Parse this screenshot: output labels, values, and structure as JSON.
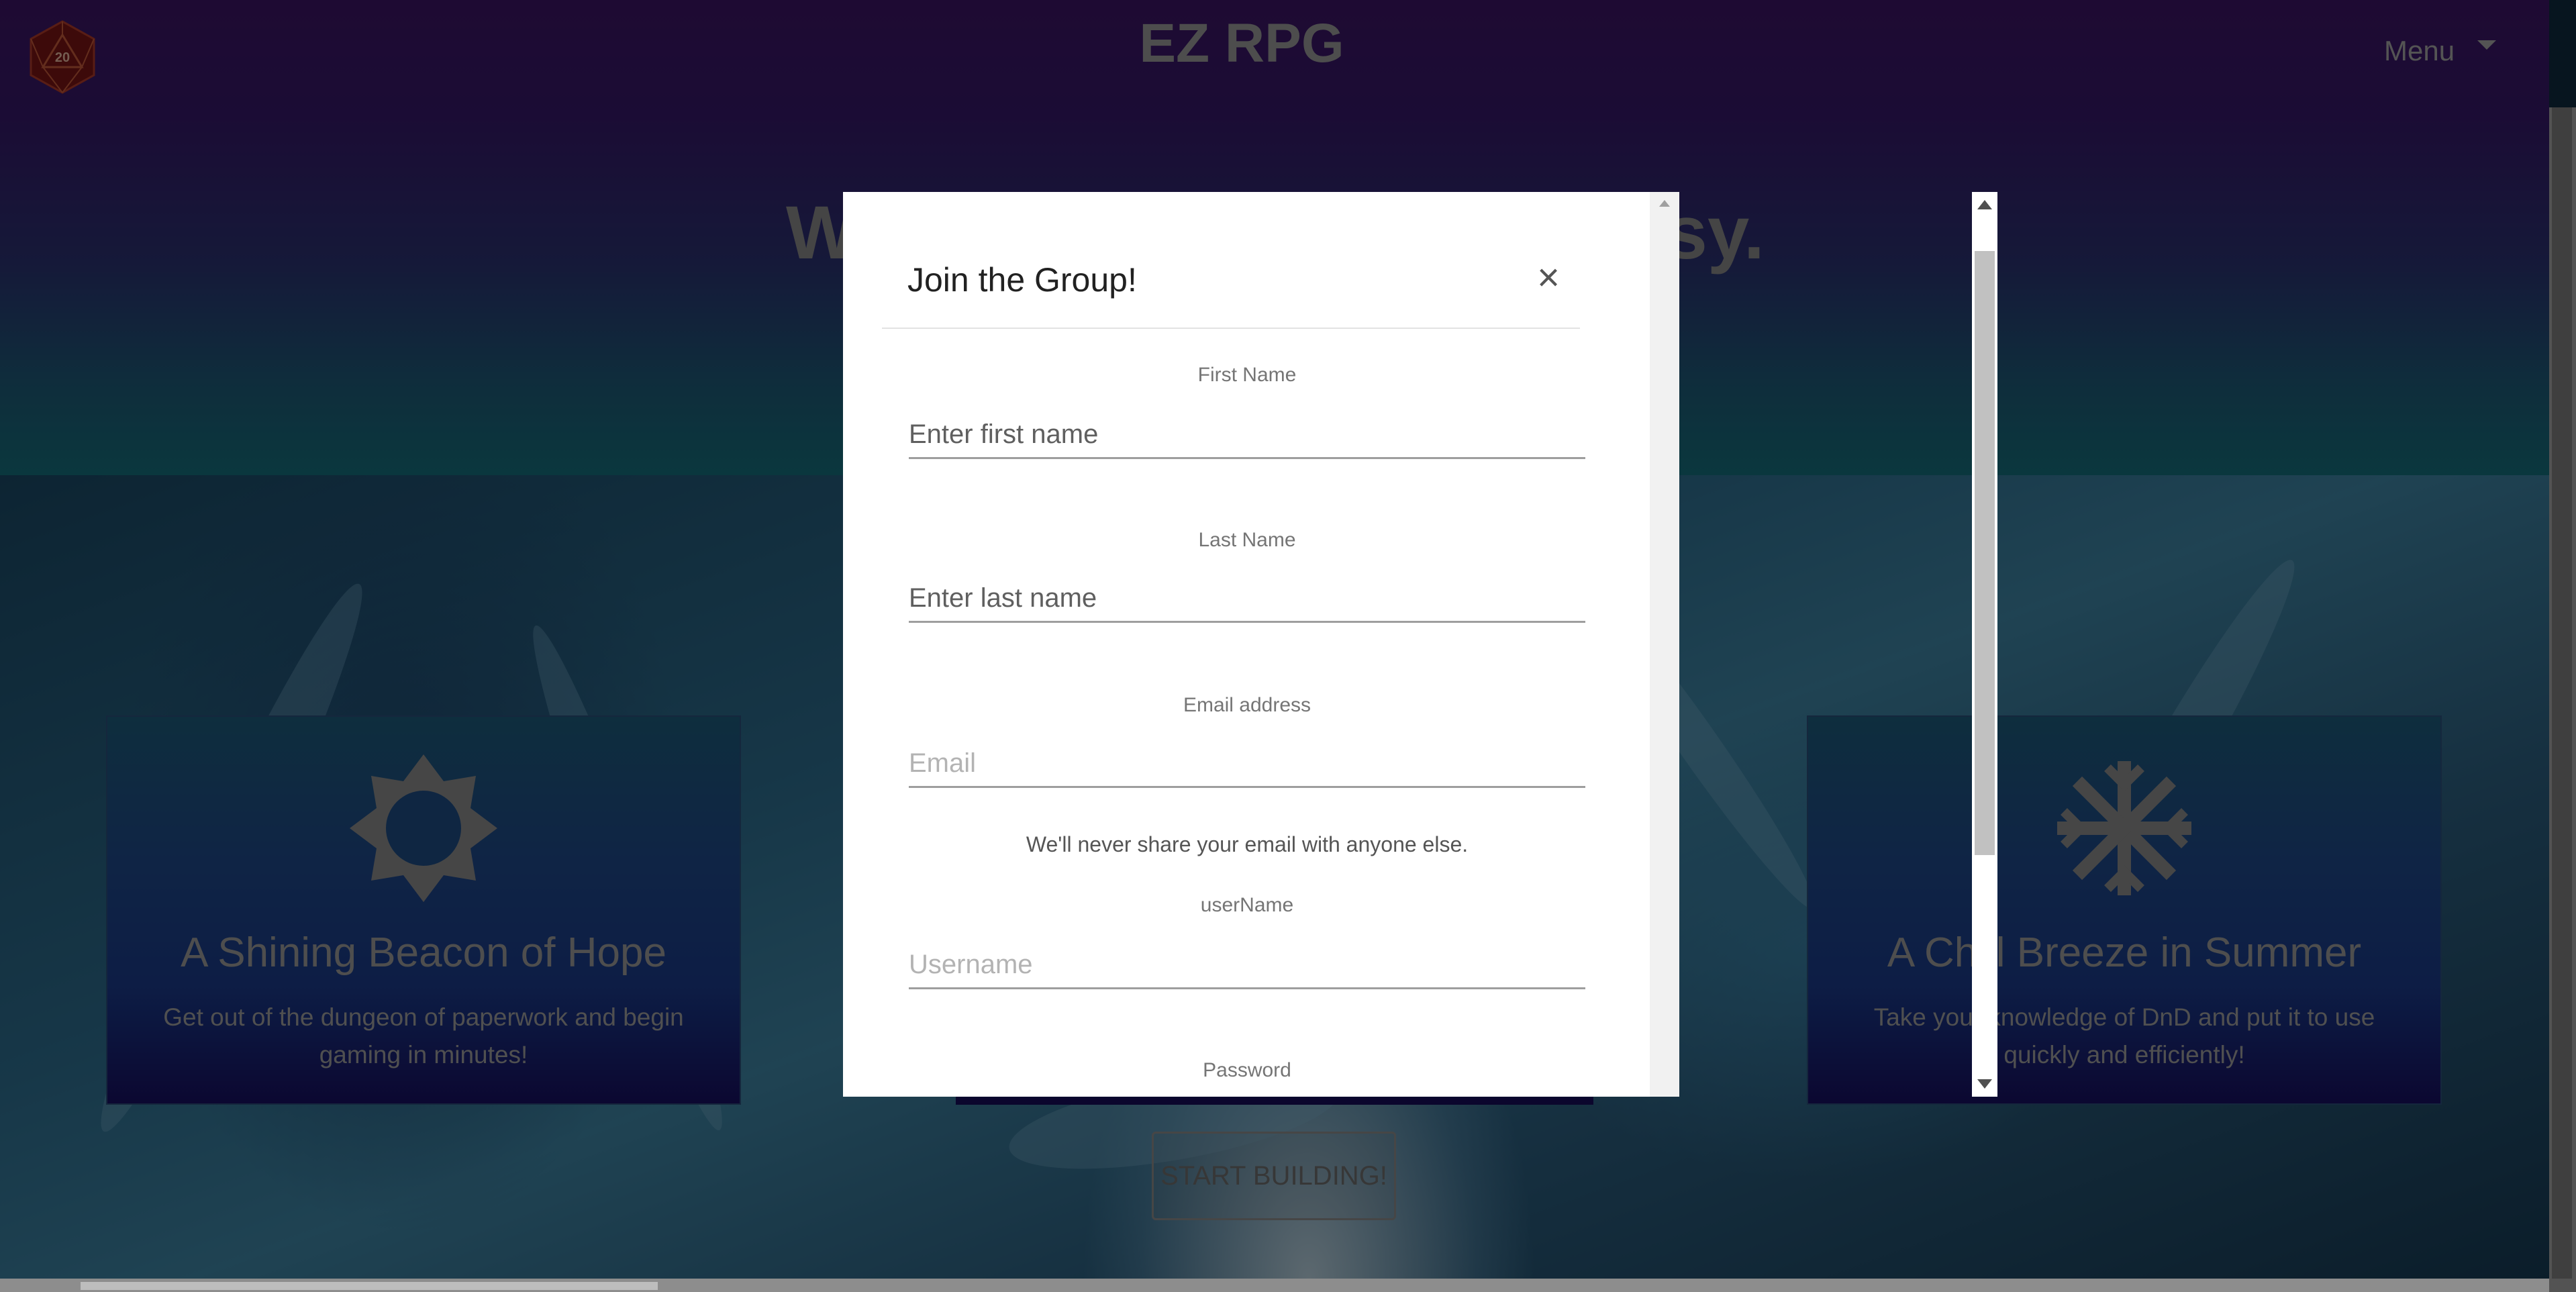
{
  "header": {
    "site_title": "EZ RPG",
    "menu_label": "Menu",
    "logo_number": "20"
  },
  "hero": {
    "headline_left": "W",
    "headline_right": "sy."
  },
  "cards": [
    {
      "icon": "sun-icon",
      "title": "A Shining Beacon of Hope",
      "text_line1": "Get out of the dungeon of paperwork and begin",
      "text_line2": "gaming in minutes!"
    },
    {
      "icon": "snowflake-icon",
      "title": "A Chill Breeze in Summer",
      "text_line1": "Take your knowledge of DnD and put it to use",
      "text_line2": "quickly and efficiently!"
    }
  ],
  "start_button": "START BUILDING!",
  "modal": {
    "title": "Join the Group!",
    "close_glyph": "×",
    "fields": {
      "first_name": {
        "label": "First Name",
        "placeholder": "Enter first name"
      },
      "last_name": {
        "label": "Last Name",
        "placeholder": "Enter last name"
      },
      "email": {
        "label": "Email address",
        "placeholder": "Email",
        "help": "We'll never share your email with anyone else."
      },
      "username": {
        "label": "userName",
        "placeholder": "Username"
      },
      "password": {
        "label": "Password"
      }
    }
  },
  "colors": {
    "header_purple": "#3d1566",
    "card_blue": "#1f4a8a",
    "modal_bg": "#ffffff"
  }
}
